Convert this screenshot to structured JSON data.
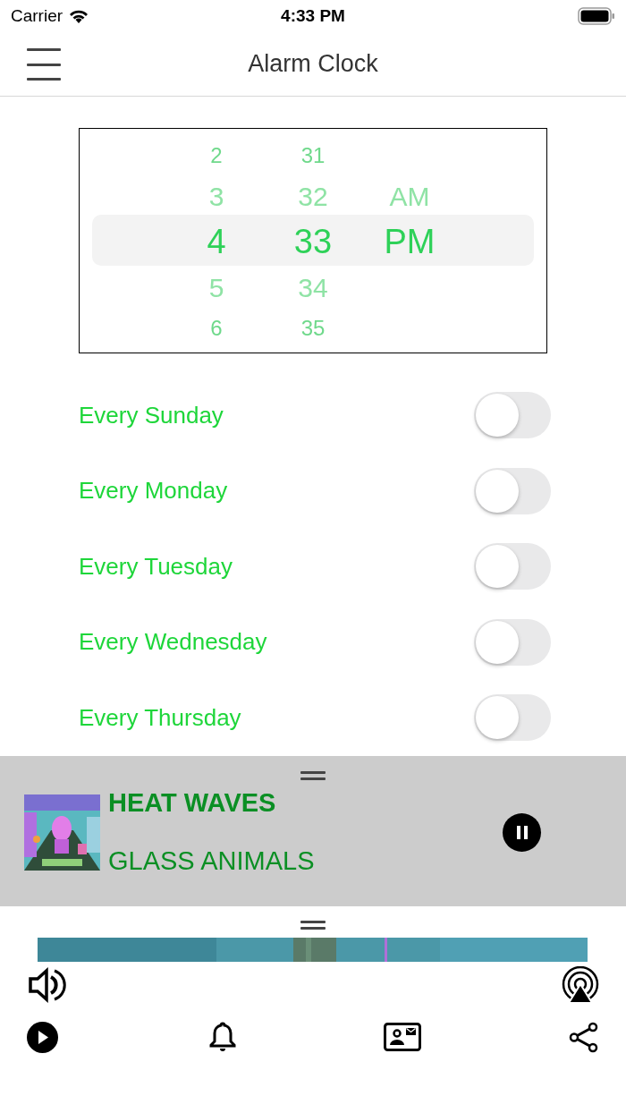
{
  "status_bar": {
    "carrier": "Carrier",
    "time": "4:33 PM"
  },
  "nav": {
    "title": "Alarm Clock"
  },
  "picker": {
    "columns": [
      {
        "items": [
          {
            "text": "2",
            "selected": false
          },
          {
            "text": "3",
            "selected": false
          },
          {
            "text": "4",
            "selected": true
          },
          {
            "text": "5",
            "selected": false
          },
          {
            "text": "6",
            "selected": false
          }
        ]
      },
      {
        "items": [
          {
            "text": "31",
            "selected": false
          },
          {
            "text": "32",
            "selected": false
          },
          {
            "text": "33",
            "selected": true
          },
          {
            "text": "34",
            "selected": false
          },
          {
            "text": "35",
            "selected": false
          }
        ]
      },
      {
        "items": [
          {
            "text": "AM",
            "selected": false
          },
          {
            "text": "PM",
            "selected": true
          }
        ]
      }
    ]
  },
  "alarms": [
    {
      "label": "Every Sunday",
      "on": false
    },
    {
      "label": "Every Monday",
      "on": false
    },
    {
      "label": "Every Tuesday",
      "on": false
    },
    {
      "label": "Every Wednesday",
      "on": false
    },
    {
      "label": "Every Thursday",
      "on": false
    }
  ],
  "now_playing": {
    "title": "HEAT WAVES",
    "artist": "GLASS ANIMALS",
    "playing": true
  }
}
